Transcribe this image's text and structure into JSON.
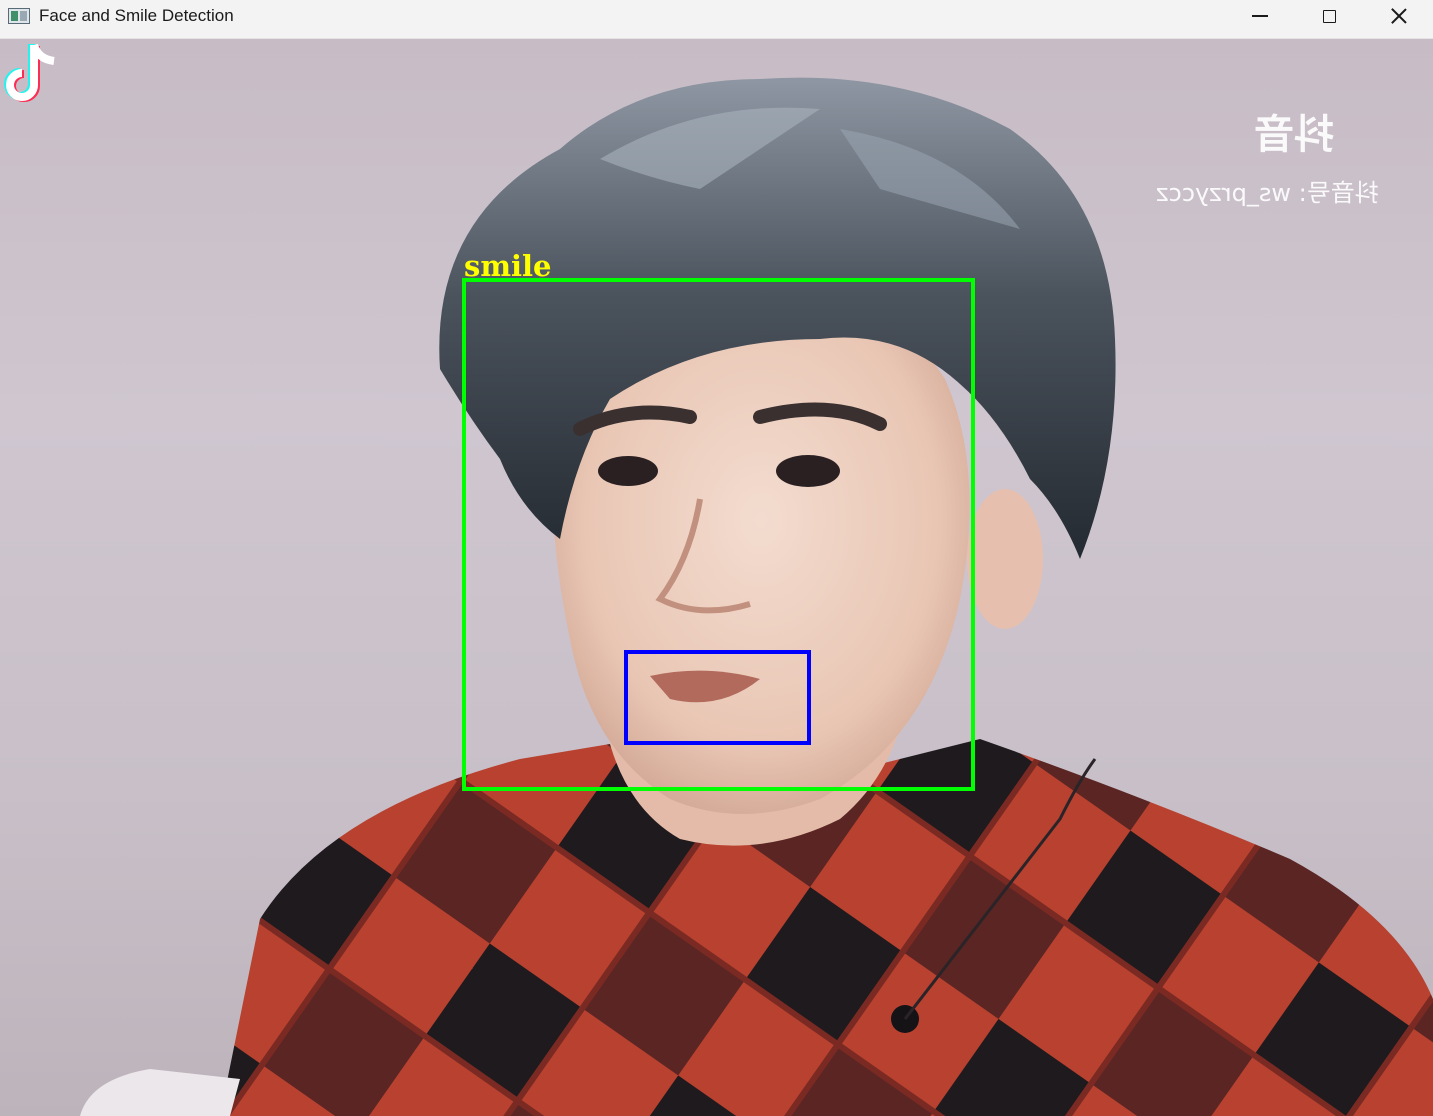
{
  "window": {
    "title": "Face and Smile Detection",
    "controls": {
      "minimize": "minimize-icon",
      "maximize": "maximize-icon",
      "close": "close-icon"
    }
  },
  "frame": {
    "detections": {
      "face_color": "#00ff00",
      "smile_color": "#0000ff",
      "label": "smile",
      "label_color": "#ffff00"
    },
    "watermark": {
      "brand": "抖音",
      "account": "抖音号: ws_przyccz"
    }
  }
}
